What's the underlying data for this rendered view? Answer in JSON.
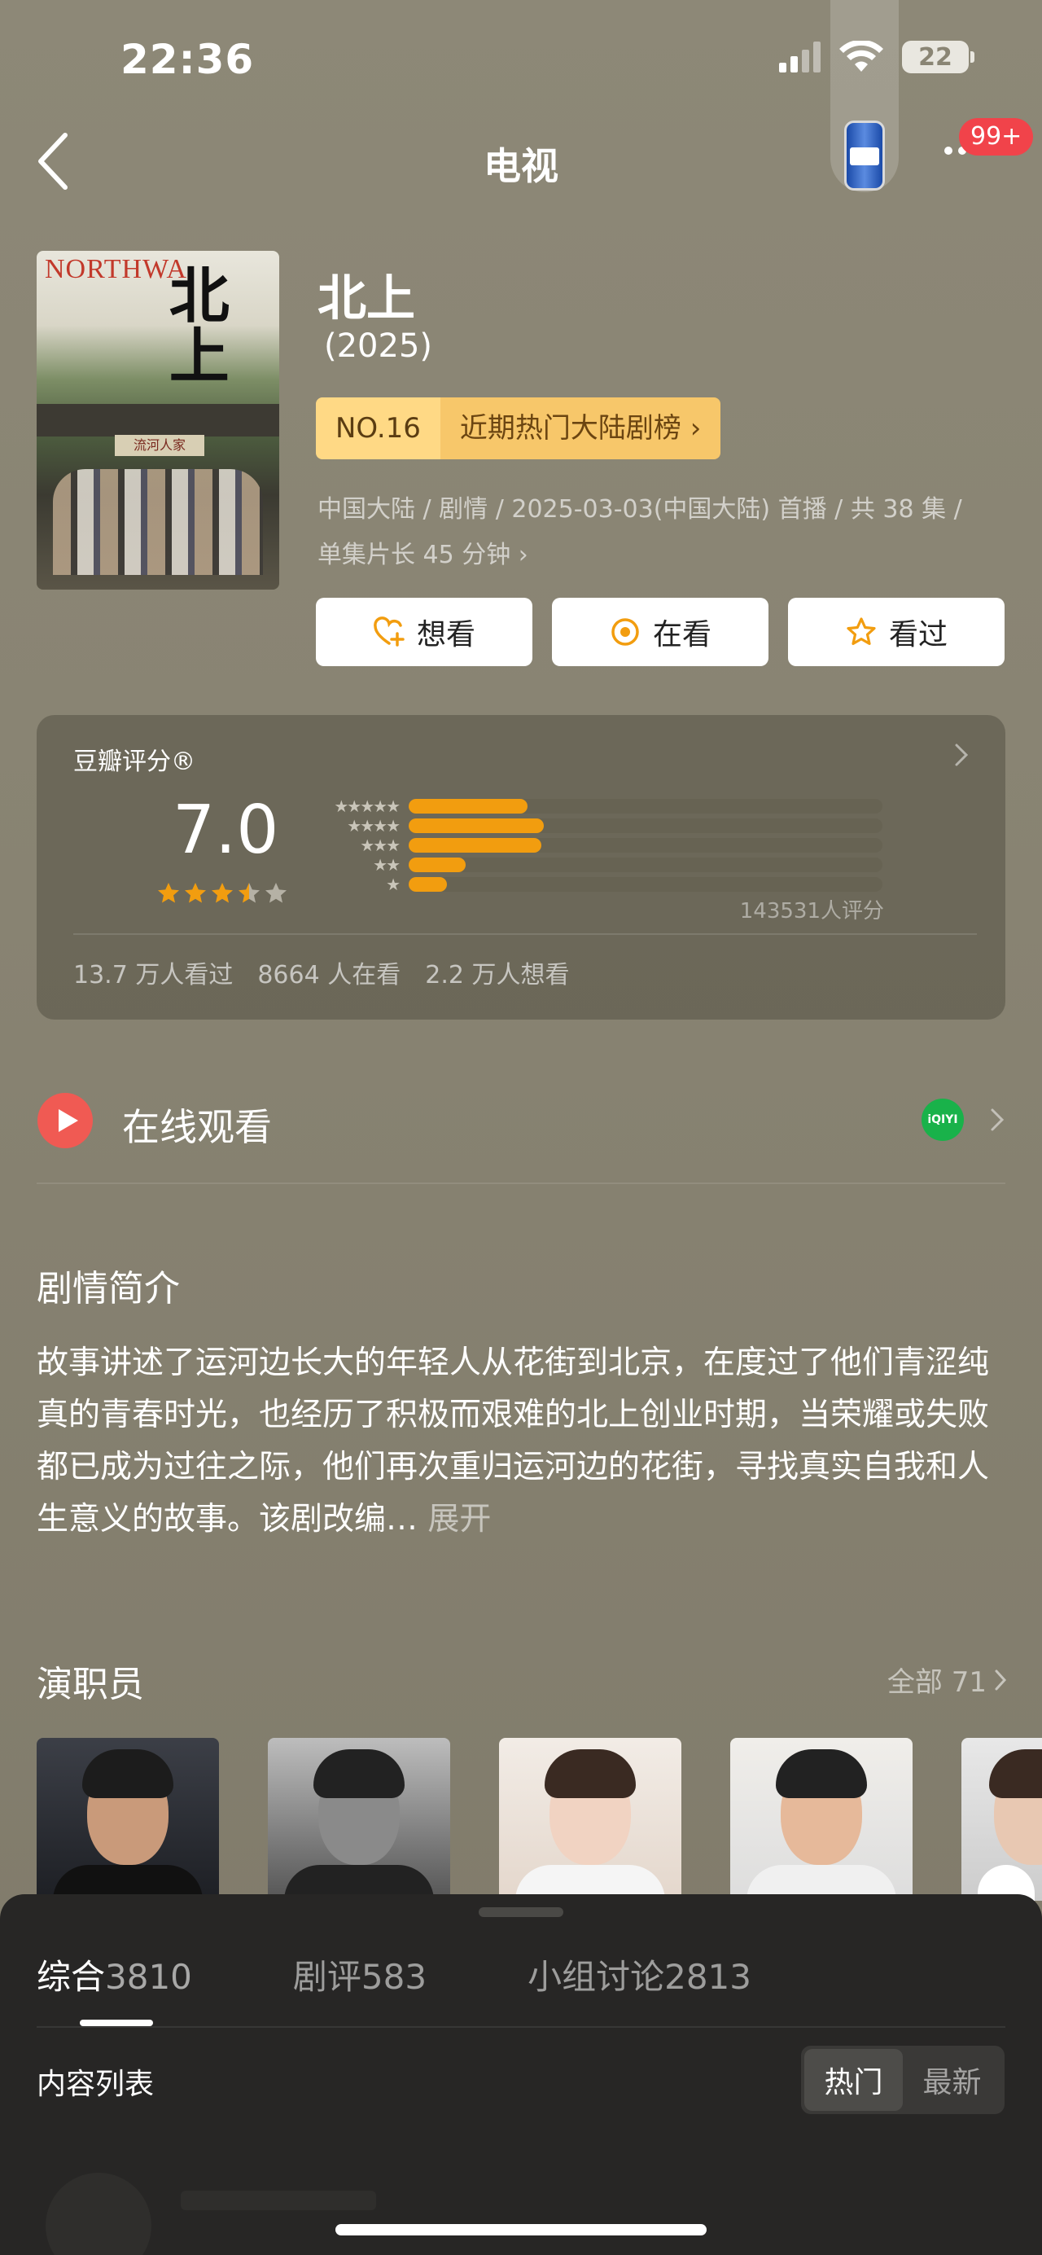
{
  "status_bar": {
    "time": "22:36",
    "battery": "22"
  },
  "nav": {
    "title": "电视",
    "badge": "99+"
  },
  "poster": {
    "title_en": "NORTHWA",
    "title_cn": "北上",
    "sign": "流河人家"
  },
  "show": {
    "title": "北上",
    "year": "(2025)",
    "rank_no": "NO.16",
    "rank_name": "近期热门大陆剧榜 ›",
    "meta_line1": "中国大陆 / 剧情 / 2025-03-03(中国大陆) 首播 / 共 38 集 /",
    "meta_line2": "单集片长 45 分钟 ›"
  },
  "actions": [
    {
      "label": "想看",
      "icon": "heart-plus-icon"
    },
    {
      "label": "在看",
      "icon": "watching-circle-icon"
    },
    {
      "label": "看过",
      "icon": "star-outline-icon"
    }
  ],
  "rating": {
    "label": "豆瓣评分®",
    "score": "7.0",
    "stars": 3.5,
    "distribution": [
      {
        "stars": "★★★★★",
        "fraction": 0.25
      },
      {
        "stars": "★★★★",
        "fraction": 0.285
      },
      {
        "stars": "★★★",
        "fraction": 0.28
      },
      {
        "stars": "★★",
        "fraction": 0.12
      },
      {
        "stars": "★",
        "fraction": 0.08
      }
    ],
    "count": "143531人评分",
    "watched": "13.7 万人看过",
    "watching": "8664 人在看",
    "wish": "2.2 万人想看",
    "accent": "#f29d0f"
  },
  "online": {
    "label": "在线观看",
    "provider": "iQIYI"
  },
  "synopsis": {
    "title": "剧情简介",
    "text": "故事讲述了运河边长大的年轻人从花街到北京，在度过了他们青涩纯真的青春时光，也经历了积极而艰难的北上创业时期，当荣耀或失败都已成为过往之际，他们再次重归运河边的花街，寻找真实自我和人生意义的故事。该剧改编…",
    "more": "展开"
  },
  "cast": {
    "title": "演职员",
    "all": "全部 71"
  },
  "sheet": {
    "tabs": [
      {
        "label": "综合",
        "count": "3810"
      },
      {
        "label": "剧评",
        "count": "583"
      },
      {
        "label": "小组讨论",
        "count": "2813"
      }
    ],
    "list_label": "内容列表",
    "sort_hot": "热门",
    "sort_new": "最新"
  }
}
